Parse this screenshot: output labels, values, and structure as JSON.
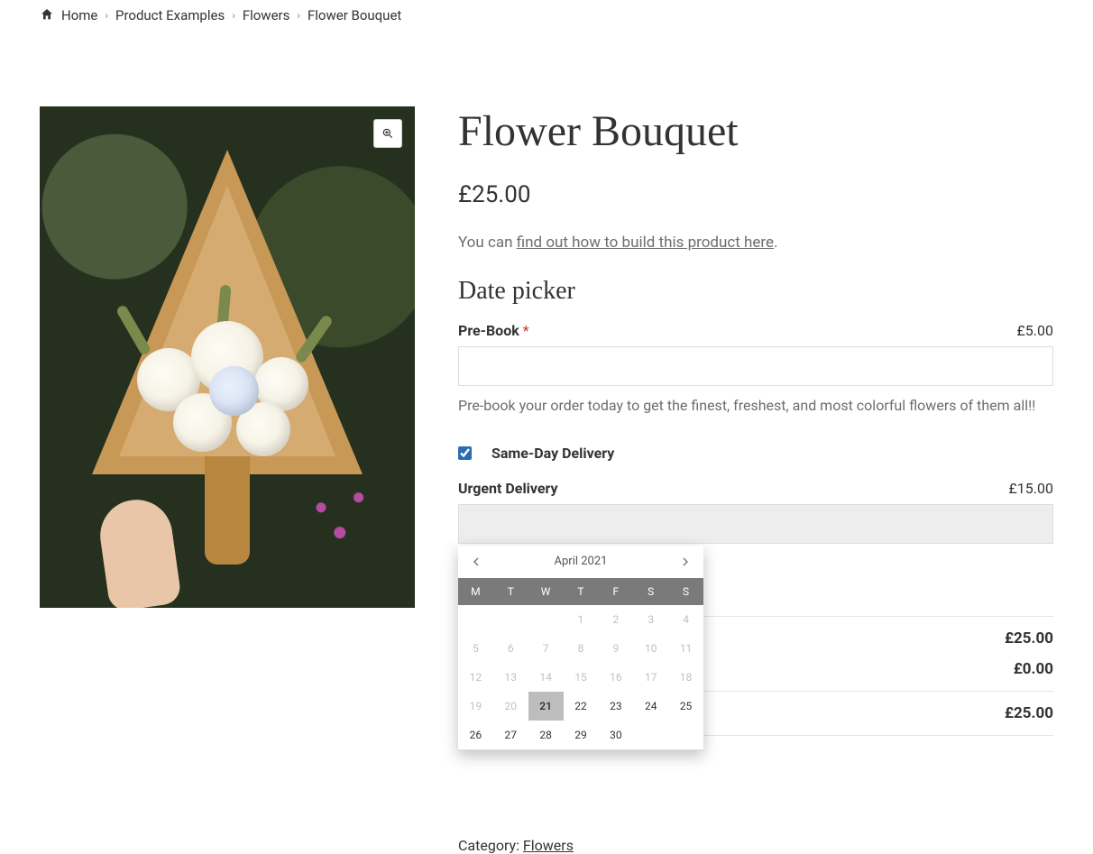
{
  "breadcrumb": {
    "home": "Home",
    "items": [
      "Product Examples",
      "Flowers"
    ],
    "current": "Flower Bouquet"
  },
  "product": {
    "title": "Flower Bouquet",
    "price": "£25.00",
    "desc_prefix": "You can ",
    "desc_link": "find out how to build this product here",
    "desc_suffix": "."
  },
  "datepicker": {
    "heading": "Date picker",
    "prebook_label": "Pre-Book ",
    "required": "*",
    "prebook_price": "£5.00",
    "prebook_value": "",
    "help": "Pre-book your order today to get the finest, freshest, and most colorful flowers of them all!!",
    "same_day_label": "Same-Day Delivery",
    "same_day_checked": true,
    "urgent_label": "Urgent Delivery",
    "urgent_price": "£15.00",
    "urgent_value": ""
  },
  "calendar": {
    "month_label": "April 2021",
    "dow": [
      "M",
      "T",
      "W",
      "T",
      "F",
      "S",
      "S"
    ],
    "leading_blanks": 3,
    "days": [
      {
        "n": 1,
        "dim": true
      },
      {
        "n": 2,
        "dim": true
      },
      {
        "n": 3,
        "dim": true
      },
      {
        "n": 4,
        "dim": true
      },
      {
        "n": 5,
        "dim": true
      },
      {
        "n": 6,
        "dim": true
      },
      {
        "n": 7,
        "dim": true
      },
      {
        "n": 8,
        "dim": true
      },
      {
        "n": 9,
        "dim": true
      },
      {
        "n": 10,
        "dim": true
      },
      {
        "n": 11,
        "dim": true
      },
      {
        "n": 12,
        "dim": true
      },
      {
        "n": 13,
        "dim": true
      },
      {
        "n": 14,
        "dim": true
      },
      {
        "n": 15,
        "dim": true
      },
      {
        "n": 16,
        "dim": true
      },
      {
        "n": 17,
        "dim": true
      },
      {
        "n": 18,
        "dim": true
      },
      {
        "n": 19,
        "dim": true
      },
      {
        "n": 20,
        "dim": true
      },
      {
        "n": 21,
        "sel": true
      },
      {
        "n": 22
      },
      {
        "n": 23
      },
      {
        "n": 24
      },
      {
        "n": 25
      },
      {
        "n": 26
      },
      {
        "n": 27
      },
      {
        "n": 28
      },
      {
        "n": 29
      },
      {
        "n": 30
      }
    ]
  },
  "totals": {
    "line1": "£25.00",
    "line2": "£0.00",
    "line3": "£25.00"
  },
  "meta": {
    "cat_label": "Category: ",
    "cat_link": "Flowers"
  }
}
